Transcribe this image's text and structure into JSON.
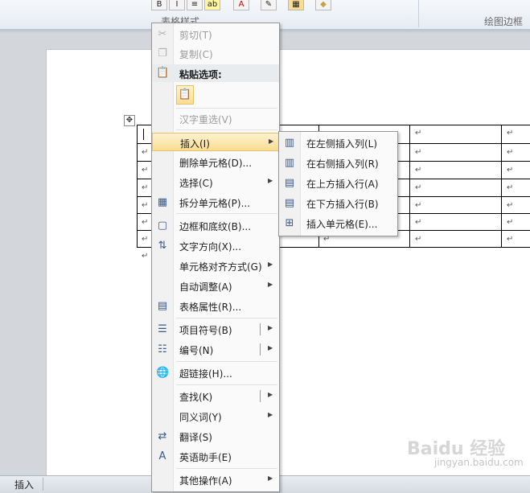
{
  "ribbon": {
    "buttons": [
      "B",
      "I",
      "≡",
      "ab",
      "A",
      "✎",
      "▦",
      "◆"
    ],
    "group_label_left": "表格样式",
    "group_label_right": "绘图边框"
  },
  "document": {
    "paragraph_mark": "↵"
  },
  "context_menu": {
    "items": [
      {
        "label": "剪切(T)",
        "icon": "scissors-icon",
        "glyph": "✂",
        "disabled": true
      },
      {
        "label": "复制(C)",
        "icon": "copy-icon",
        "glyph": "❐",
        "disabled": true
      },
      {
        "label": "粘贴选项:",
        "icon": "paste-icon",
        "glyph": "📋",
        "header": true
      },
      {
        "label": "汉字重选(V)",
        "disabled": true
      },
      {
        "label": "插入(I)",
        "submenu": true,
        "highlighted": true
      },
      {
        "label": "删除单元格(D)...",
        "icon": "delete-cells-icon",
        "glyph": "▦"
      },
      {
        "label": "选择(C)",
        "submenu": true
      },
      {
        "label": "拆分单元格(P)...",
        "icon": "split-cells-icon",
        "glyph": "▦"
      },
      {
        "label": "边框和底纹(B)...",
        "icon": "borders-icon",
        "glyph": "▢"
      },
      {
        "label": "文字方向(X)...",
        "icon": "text-direction-icon",
        "glyph": "⇅"
      },
      {
        "label": "单元格对齐方式(G)",
        "submenu": true
      },
      {
        "label": "自动调整(A)",
        "submenu": true
      },
      {
        "label": "表格属性(R)...",
        "icon": "table-properties-icon",
        "glyph": "▤"
      },
      {
        "label": "项目符号(B)",
        "icon": "bullets-icon",
        "glyph": "☰",
        "submenu": true,
        "split": true
      },
      {
        "label": "编号(N)",
        "icon": "numbering-icon",
        "glyph": "☷",
        "submenu": true,
        "split": true
      },
      {
        "label": "超链接(H)...",
        "icon": "hyperlink-icon",
        "glyph": "🌐"
      },
      {
        "label": "查找(K)",
        "submenu": true,
        "split": true
      },
      {
        "label": "同义词(Y)",
        "submenu": true
      },
      {
        "label": "翻译(S)",
        "icon": "translate-icon",
        "glyph": "⇄"
      },
      {
        "label": "英语助手(E)",
        "icon": "english-assistant-icon",
        "glyph": "A"
      },
      {
        "label": "其他操作(A)",
        "submenu": true
      }
    ]
  },
  "submenu": {
    "items": [
      {
        "label": "在左侧插入列(L)",
        "icon": "insert-column-left-icon",
        "glyph": "▥"
      },
      {
        "label": "在右侧插入列(R)",
        "icon": "insert-column-right-icon",
        "glyph": "▥"
      },
      {
        "label": "在上方插入行(A)",
        "icon": "insert-row-above-icon",
        "glyph": "▤"
      },
      {
        "label": "在下方插入行(B)",
        "icon": "insert-row-below-icon",
        "glyph": "▤"
      },
      {
        "label": "插入单元格(E)...",
        "icon": "insert-cells-icon",
        "glyph": "⊞"
      }
    ]
  },
  "statusbar": {
    "mode": "插入"
  },
  "watermark": {
    "brand": "Baidu 经验",
    "url": "jingyan.baidu.com"
  },
  "colors": {
    "highlight_top": "#fdf2cf",
    "highlight_bottom": "#f9dd92",
    "highlight_border": "#e5c365",
    "menu_bg": "#fafafa"
  }
}
